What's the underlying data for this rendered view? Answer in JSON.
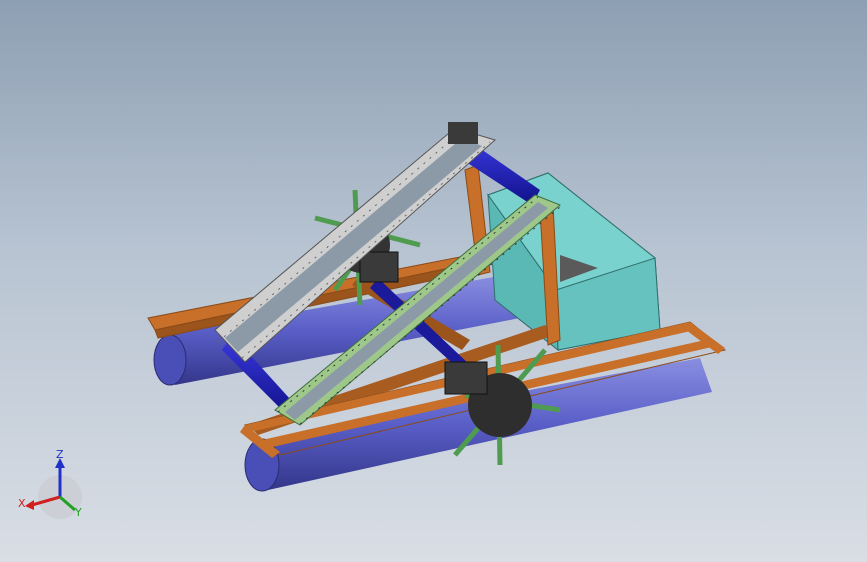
{
  "viewport": {
    "background_top": "#8d9fb3",
    "background_bottom": "#d9dee5"
  },
  "model": {
    "colors": {
      "frame": "#c8702a",
      "frame_dark": "#8a4a18",
      "pontoon": "#5a5fc8",
      "pontoon_dark": "#34368a",
      "shaft": "#1e1ec8",
      "hopper": "#66c2bf",
      "hopper_dark": "#3e8f8c",
      "conveyor_gray": "#b8b8b8",
      "conveyor_green": "#9ec88a",
      "paddle": "#4f9b4f",
      "motor": "#3a3a3a",
      "wheel": "#2e2e2e"
    }
  },
  "triad": {
    "z_label": "Z",
    "x_label": "X",
    "y_label": "Y",
    "x_color": "#d02020",
    "y_color": "#20a020",
    "z_color": "#2030c8"
  }
}
